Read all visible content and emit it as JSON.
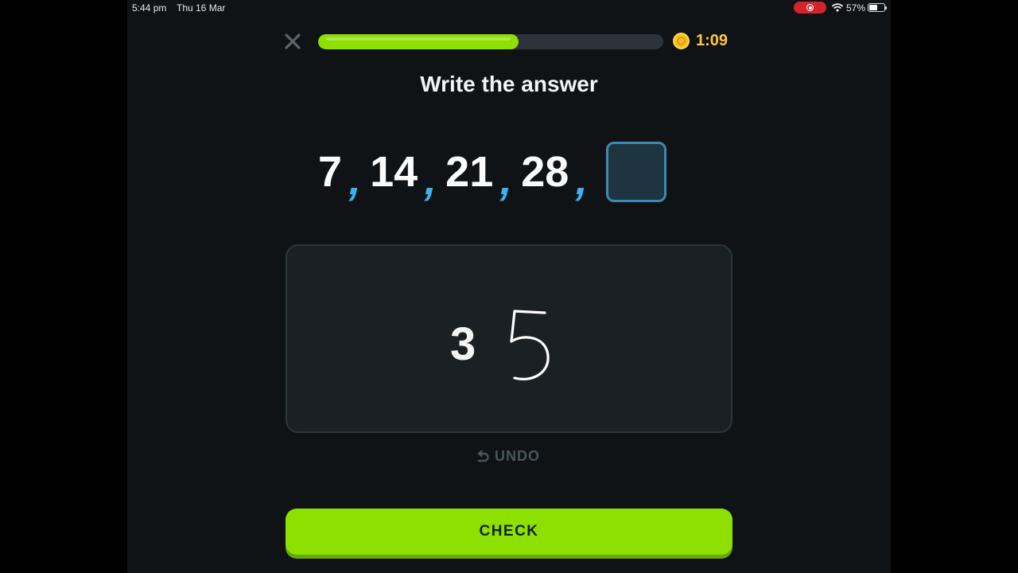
{
  "status_bar": {
    "time": "5:44 pm",
    "date": "Thu 16 Mar",
    "battery": "57%",
    "icons": [
      "screen-record-icon",
      "wifi-icon",
      "battery-icon"
    ]
  },
  "lesson": {
    "progress_fraction": 0.58,
    "timer": "1:09",
    "icons": [
      "close-icon",
      "coin-icon"
    ]
  },
  "prompt": {
    "title": "Write the answer"
  },
  "sequence": {
    "numbers": [
      "7",
      "14",
      "21",
      "28"
    ],
    "separator": ","
  },
  "canvas": {
    "recognized_digit": "3",
    "handwritten_digit": "5"
  },
  "actions": {
    "undo_label": "UNDO",
    "check_label": "CHECK"
  },
  "colors": {
    "accent_green": "#8ee000",
    "comma_blue": "#39b3f2",
    "timer_gold": "#ffc738",
    "background": "#0f1316"
  }
}
